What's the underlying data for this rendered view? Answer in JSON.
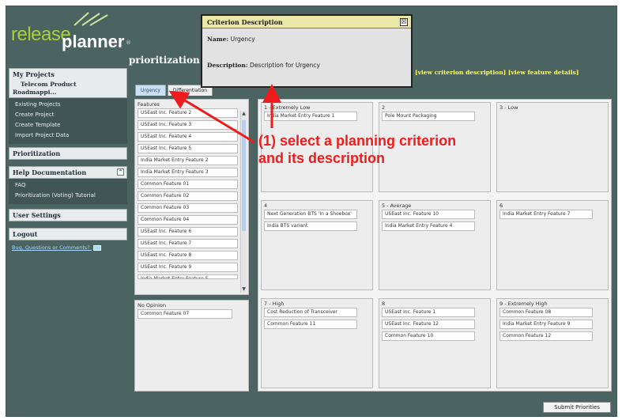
{
  "app": {
    "logo_word1": "release",
    "logo_word2": "planner",
    "logo_reg": "®"
  },
  "page_title": "prioritization",
  "sidebar": {
    "my_projects": "My Projects",
    "project_name_line1": "Telecom Product",
    "project_name_line2": "Roadmappi...",
    "project_items": [
      "Existing Projects",
      "Create Project",
      "Create Template",
      "Import Project Data"
    ],
    "prioritization": "Prioritization",
    "help": "Help Documentation",
    "help_items": [
      "FAQ",
      "Prioritization (Voting) Tutorial"
    ],
    "user_settings": "User Settings",
    "logout": "Logout",
    "bug_link": "Bug, Questions or Comments?"
  },
  "links": {
    "criterion": "[view criterion description]",
    "feature": "[view feature details]"
  },
  "tabs": [
    {
      "label": "Urgency"
    },
    {
      "label": "Differentiation"
    }
  ],
  "features_panel": {
    "label": "Features",
    "items": [
      "USEast Inc. Feature 2",
      "USEast Inc. Feature 3",
      "USEast Inc. Feature 4",
      "USEast Inc. Feature 5",
      "India Market Entry Feature 2",
      "India Market Entry Feature 3",
      "Common Feature 01",
      "Common Feature 02",
      "Common Feature 03",
      "Common Feature 04",
      "USEast Inc. Feature 6",
      "USEast Inc. Feature 7",
      "USEast Inc. Feature 8",
      "USEast Inc. Feature 9",
      "India Market Entry Feature 5"
    ]
  },
  "no_opinion": {
    "label": "No Opinion",
    "items": [
      "Common Feature 07"
    ]
  },
  "buckets": [
    {
      "label": "1 - Extremely Low",
      "items": [
        "India Market Entry Feature 1"
      ]
    },
    {
      "label": "2",
      "items": [
        "Pole Mount Packaging"
      ]
    },
    {
      "label": "3 - Low",
      "items": []
    },
    {
      "label": "4",
      "items": [
        "Next Generation BTS 'In a Shoebox'",
        "India BTS variant"
      ]
    },
    {
      "label": "5 - Average",
      "items": [
        "USEast Inc. Feature 10",
        "India Market Entry Feature 4"
      ]
    },
    {
      "label": "6",
      "items": [
        "India Market Entry Feature 7"
      ]
    },
    {
      "label": "7 - High",
      "items": [
        "Cost Reduction of Transceiver",
        "Common Feature 11"
      ]
    },
    {
      "label": "8",
      "items": [
        "USEast Inc. Feature 1",
        "USEast Inc. Feature 12",
        "Common Feature 10"
      ]
    },
    {
      "label": "9 - Extremely High",
      "items": [
        "Common Feature 08",
        "India Market Entry Feature 9",
        "Common Feature 12"
      ]
    }
  ],
  "popup": {
    "title": "Criterion Description",
    "close": "☒",
    "name_label": "Name:",
    "name_value": "Urgency",
    "desc_label": "Description:",
    "desc_value": "Description for Urgency"
  },
  "annotation": {
    "line1": "(1) select a planning criterion",
    "line2": "and its description"
  },
  "submit": "Submit Priorities",
  "colors": {
    "accent_red": "#ee1c1c",
    "link_yellow": "#ffff66",
    "frame": "#4b6361"
  }
}
